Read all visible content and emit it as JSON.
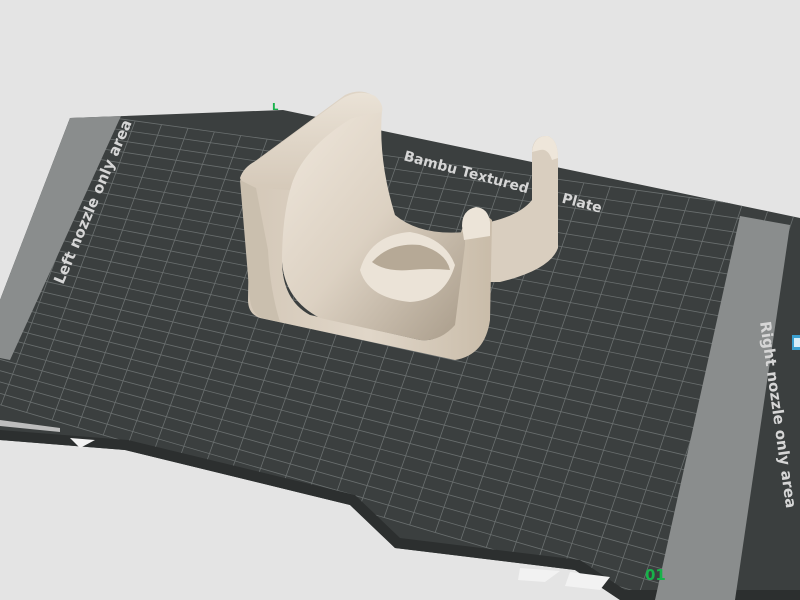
{
  "plate": {
    "name": "Bambu Textured PEI Plate",
    "left_zone_label": "Left nozzle only area",
    "right_zone_label": "Right nozzle only area",
    "plate_number": "01",
    "corner_mark": "L"
  },
  "colors": {
    "background": "#e4e4e4",
    "plate": "#3b3f3f",
    "zone": "#8e9191",
    "model": "#dcd1c2",
    "plate_number": "#18b24a"
  }
}
